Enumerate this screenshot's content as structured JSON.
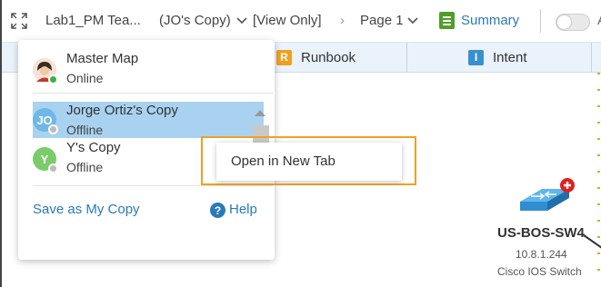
{
  "toolbar": {
    "title": "Lab1_PM Tea...",
    "copy_label": "(JO's Copy)",
    "view_mode": "[View Only]",
    "separator": "›",
    "page_label": "Page 1",
    "summary_label": "Summary",
    "cut_text": "A"
  },
  "tabs": [
    {
      "badge": "R",
      "label": "Runbook",
      "badge_color": "#f0a020"
    },
    {
      "badge": "I",
      "label": "Intent",
      "badge_color": "#3a8fd0"
    }
  ],
  "copies_panel": {
    "items": [
      {
        "name": "Master Map",
        "status": "Online",
        "avatar_text": "",
        "status_color": "#3cb043"
      },
      {
        "name": "Jorge Ortiz's Copy",
        "status": "Offline",
        "avatar_text": "JO",
        "avatar_color": "#6fb7e6",
        "status_color": "#bbbbbb",
        "selected": true
      },
      {
        "name": "Y's Copy",
        "status": "Offline",
        "avatar_text": "Y",
        "avatar_color": "#7acb6a",
        "status_color": "#bbbbbb"
      }
    ],
    "save_label": "Save as My Copy",
    "help_label": "Help",
    "help_icon_text": "?"
  },
  "context_menu": {
    "items": [
      "Open in New Tab"
    ]
  },
  "device": {
    "name": "US-BOS-SW4",
    "ip": "10.8.1.244",
    "type": "Cisco IOS Switch"
  },
  "colors": {
    "accent": "#2a7ab8",
    "highlight": "#f0a020",
    "selected_row": "#a8d2f0"
  }
}
